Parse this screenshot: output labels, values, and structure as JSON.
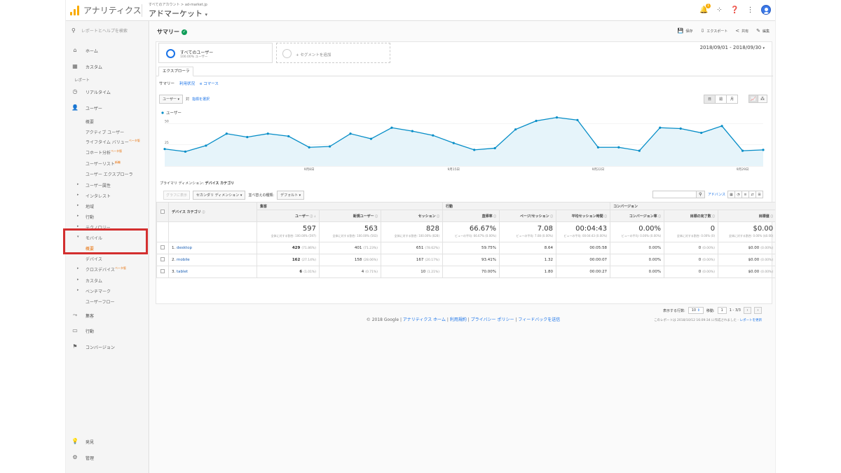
{
  "app": {
    "name": "アナリティクス",
    "account_sub": "すべてのアカウント > ad-market.jp",
    "account_name": "アドマーケット"
  },
  "topbar": {
    "notification_count": "1"
  },
  "sidebar": {
    "search_placeholder": "レポートとヘルプを検索",
    "home": "ホーム",
    "custom_top": "カスタム",
    "reports_header": "レポート",
    "realtime": "リアルタイム",
    "users": "ユーザー",
    "sub": [
      "概要",
      "アクティブ ユーザー",
      "ライフタイム バリュー",
      "コホート分析",
      "ユーザーリスト",
      "ユーザー エクスプローラ",
      "ユーザー属性",
      "インタレスト",
      "地域",
      "行動",
      "テクノロジー",
      "モバイル",
      "概要",
      "デバイス",
      "クロスデバイス",
      "カスタム",
      "ベンチマーク",
      "ユーザーフロー"
    ],
    "beta": "ベータ版",
    "new_badge": "新機",
    "acquisition": "集客",
    "behavior": "行動",
    "conversions": "コンバージョン",
    "discover": "発見",
    "admin": "管理"
  },
  "main": {
    "title": "サマリー",
    "actions": [
      "保存",
      "エクスポート",
      "共有",
      "編集"
    ],
    "segment_all": "すべてのユーザー",
    "segment_all_sub": "100.00% ユーザー",
    "segment_add": "+ セグメントを追加",
    "date_range": "2018/09/01 - 2018/09/30",
    "tab": "エクスプローラ",
    "subtabs": [
      "サマリー",
      "利用状況",
      "e コマース"
    ],
    "metric_dd": "ユーザー",
    "vs": "対",
    "select_metric": "指標を選択",
    "periods": [
      "日",
      "週",
      "月"
    ],
    "legend": "ユーザー",
    "primary_dim_label": "プライマリ ディメンション:",
    "primary_dim_value": "デバイス カテゴリ",
    "plot_rows": "グラフに表示",
    "secondary_dim": "セカンダリ ディメンション",
    "sort_label": "並べ替えの種類:",
    "sort_value": "デフォルト",
    "advanced": "アドバンス"
  },
  "chart_data": {
    "type": "line",
    "series": [
      {
        "name": "ユーザー",
        "values": [
          20,
          17,
          24,
          38,
          34,
          38,
          35,
          22,
          23,
          38,
          32,
          45,
          41,
          36,
          27,
          19,
          21,
          43,
          53,
          57,
          54,
          22,
          22,
          18,
          45,
          44,
          39,
          47,
          18,
          19
        ]
      }
    ],
    "x": [
      1,
      2,
      3,
      4,
      5,
      6,
      7,
      8,
      9,
      10,
      11,
      12,
      13,
      14,
      15,
      16,
      17,
      18,
      19,
      20,
      21,
      22,
      23,
      24,
      25,
      26,
      27,
      28,
      29,
      30
    ],
    "x_tick_labels": [
      "9月8日",
      "9月15日",
      "9月22日",
      "9月29日"
    ],
    "y_tick_labels": [
      "50",
      "25"
    ],
    "ylim": [
      0,
      60
    ],
    "grid": true,
    "color": "#058dc7"
  },
  "table": {
    "dim_header": "デバイス カテゴリ",
    "groups": [
      "集客",
      "行動",
      "コンバージョン"
    ],
    "cols": [
      "ユーザー",
      "新規ユーザー",
      "セッション",
      "直帰率",
      "ページ/セッション",
      "平均セッション時間",
      "コンバージョン率",
      "目標の完了数",
      "目標値"
    ],
    "totals": [
      {
        "v": "597",
        "s": "全体に対する割合: 100.00% (597)"
      },
      {
        "v": "563",
        "s": "全体に対する割合: 100.00% (563)"
      },
      {
        "v": "828",
        "s": "全体に対する割合: 100.00% (828)"
      },
      {
        "v": "66.67%",
        "s": "ビューの平均: 66.67% (0.00%)"
      },
      {
        "v": "7.08",
        "s": "ビューの平均: 7.08 (0.00%)"
      },
      {
        "v": "00:04:43",
        "s": "ビューの平均: 00:04:43 (0.00%)"
      },
      {
        "v": "0.00%",
        "s": "ビューの平均: 0.00% (0.00%)"
      },
      {
        "v": "0",
        "s": "全体に対する割合: 0.00% (0)"
      },
      {
        "v": "$0.00",
        "s": "全体に対する割合: 0.00% ($0.00)"
      }
    ],
    "rows": [
      {
        "n": "1.",
        "name": "desktop",
        "c": [
          [
            "429",
            "(71.86%)"
          ],
          [
            "401",
            "(71.23%)"
          ],
          [
            "651",
            "(78.62%)"
          ],
          [
            "59.75%",
            ""
          ],
          [
            "8.64",
            ""
          ],
          [
            "00:05:58",
            ""
          ],
          [
            "0.00%",
            ""
          ],
          [
            "0",
            "(0.00%)"
          ],
          [
            "$0.00",
            "(0.00%)"
          ]
        ]
      },
      {
        "n": "2.",
        "name": "mobile",
        "c": [
          [
            "162",
            "(27.14%)"
          ],
          [
            "158",
            "(28.06%)"
          ],
          [
            "167",
            "(20.17%)"
          ],
          [
            "93.41%",
            ""
          ],
          [
            "1.32",
            ""
          ],
          [
            "00:00:07",
            ""
          ],
          [
            "0.00%",
            ""
          ],
          [
            "0",
            "(0.00%)"
          ],
          [
            "$0.00",
            "(0.00%)"
          ]
        ]
      },
      {
        "n": "3.",
        "name": "tablet",
        "c": [
          [
            "6",
            "(1.01%)"
          ],
          [
            "4",
            "(0.71%)"
          ],
          [
            "10",
            "(1.21%)"
          ],
          [
            "70.00%",
            ""
          ],
          [
            "1.80",
            ""
          ],
          [
            "00:00:27",
            ""
          ],
          [
            "0.00%",
            ""
          ],
          [
            "0",
            "(0.00%)"
          ],
          [
            "$0.00",
            "(0.00%)"
          ]
        ]
      }
    ],
    "rows_label": "表示する行数:",
    "rows_value": "10",
    "goto_label": "移動:",
    "goto_value": "1",
    "range": "1 - 3/3",
    "generated": "このレポートは 2018/10/12 16:09:34 に作成されました -",
    "refresh": "レポートを更新"
  },
  "footer": {
    "copyright": "© 2018 Google |",
    "links": [
      "アナリティクス ホーム",
      "利用規約",
      "プライバシー ポリシー",
      "フィードバックを送信"
    ]
  }
}
